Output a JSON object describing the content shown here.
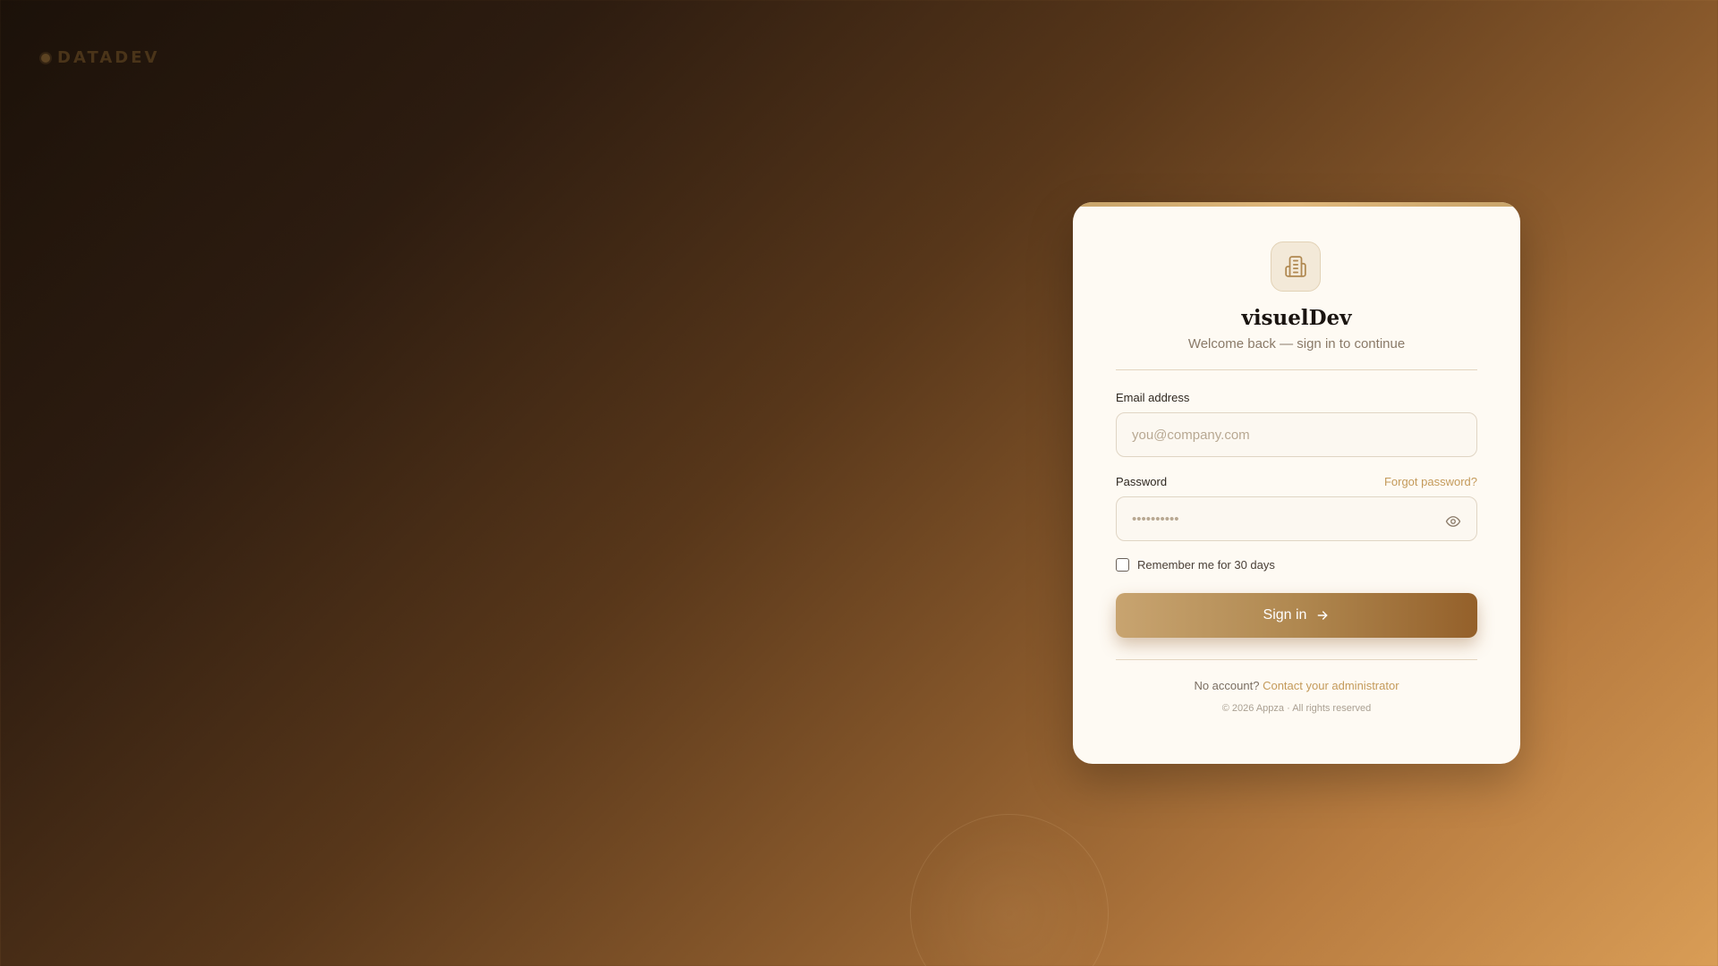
{
  "brand": {
    "name": "DATADEV"
  },
  "card": {
    "title": "visuelDev",
    "subtitle": "Welcome back — sign in to continue",
    "logo_icon": "building-icon"
  },
  "form": {
    "email_label": "Email address",
    "email_placeholder": "you@company.com",
    "email_value": "",
    "password_label": "Password",
    "password_placeholder": "••••••••••",
    "password_value": "",
    "forgot_label": "Forgot password?",
    "remember_label": "Remember me for 30 days",
    "remember_checked": false,
    "signin_label": "Sign in"
  },
  "footer": {
    "prompt": "No account?",
    "link_label": "Contact your administrator",
    "copyright": "© 2026 Appza · All rights reserved"
  },
  "colors": {
    "accent": "#c49a5a",
    "card_bg": "#fefaf3",
    "button_start": "#c8a470",
    "button_end": "#94602a"
  }
}
